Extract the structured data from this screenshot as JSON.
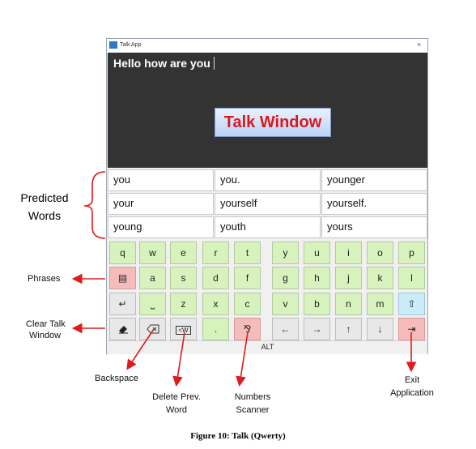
{
  "window": {
    "title": "Talk App",
    "close": "×"
  },
  "text_area": {
    "content": "Hello how are you"
  },
  "talk_button": "Talk Window",
  "predictions": [
    [
      "you",
      "you.",
      "younger"
    ],
    [
      "your",
      "yourself",
      "yourself."
    ],
    [
      "young",
      "youth",
      "yours"
    ]
  ],
  "keyboard": {
    "row1": [
      "q",
      "w",
      "e",
      "r",
      "t",
      "y",
      "u",
      "i",
      "o",
      "p"
    ],
    "row2": [
      "a",
      "s",
      "d",
      "f",
      "g",
      "h",
      "j",
      "k",
      "l"
    ],
    "row2_phrases_icon": "▤",
    "row3": [
      "z",
      "x",
      "c",
      "v",
      "b",
      "n",
      "m"
    ],
    "row3_enter_icon": "↵",
    "row3_space_icon": "⎵",
    "row3_shift_icon": "⇧",
    "row4": {
      "clear": "⌫",
      "backspace": "⌫",
      "delete_word": "W",
      "period": ".",
      "numbers": "⅋",
      "left": "←",
      "right": "→",
      "up": "↑",
      "down": "↓",
      "exit": "⇥"
    },
    "alt_label": "ALT"
  },
  "annotations": {
    "predicted_words": "Predicted Words",
    "phrases": "Phrases",
    "clear_talk_window_1": "Clear Talk",
    "clear_talk_window_2": "Window",
    "backspace": "Backspace",
    "delete_prev_word_1": "Delete Prev.",
    "delete_prev_word_2": "Word",
    "numbers_scanner_1": "Numbers",
    "numbers_scanner_2": "Scanner",
    "exit_application_1": "Exit",
    "exit_application_2": "Application"
  },
  "caption": "Figure 10: Talk (Qwerty)",
  "colors": {
    "arrow": "#e11b1b",
    "talk_text": "#d9191f",
    "key_green": "#d7f2bc",
    "key_red": "#f6bcbc",
    "key_gray": "#e8e8e8",
    "key_blue": "#c9ecf8"
  }
}
